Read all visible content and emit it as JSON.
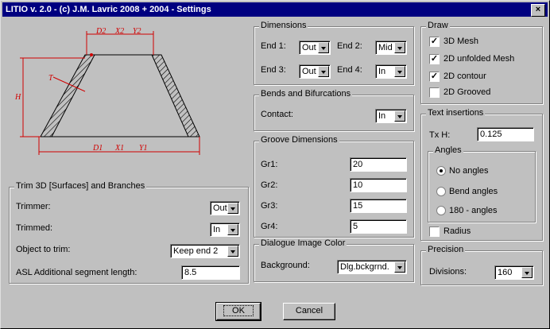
{
  "window": {
    "title": "LITIO v. 2.0 - (c) J.M. Lavric 2008 + 2004 - Settings",
    "close": "×"
  },
  "diagram": {
    "labels": {
      "d2": "D2",
      "x2": "X2",
      "y2": "Y2",
      "d1": "D1",
      "x1": "X1",
      "y1": "Y1",
      "h": "H",
      "t": "T"
    }
  },
  "dimensions": {
    "title": "Dimensions",
    "end1": {
      "label": "End 1:",
      "value": "Out"
    },
    "end2": {
      "label": "End 2:",
      "value": "Mid"
    },
    "end3": {
      "label": "End 3:",
      "value": "Out"
    },
    "end4": {
      "label": "End 4:",
      "value": "In"
    }
  },
  "bends": {
    "title": "Bends and Bifurcations",
    "contact_label": "Contact:",
    "contact_value": "In"
  },
  "groove": {
    "title": "Groove Dimensions",
    "rows": [
      {
        "label": "Gr1:",
        "value": "20"
      },
      {
        "label": "Gr2:",
        "value": "10"
      },
      {
        "label": "Gr3:",
        "value": "15"
      },
      {
        "label": "Gr4:",
        "value": "5"
      }
    ]
  },
  "dialogue_color": {
    "title": "Dialogue Image Color",
    "background_label": "Background:",
    "background_value": "Dlg.bckgrnd."
  },
  "trim": {
    "title": "Trim 3D [Surfaces] and Branches",
    "trimmer_label": "Trimmer:",
    "trimmer_value": "Out",
    "trimmed_label": "Trimmed:",
    "trimmed_value": "In",
    "object_label": "Object to trim:",
    "object_value": "Keep end 2",
    "asl_label": "ASL Additional segment length:",
    "asl_value": "8.5"
  },
  "draw": {
    "title": "Draw",
    "items": [
      {
        "label": "3D Mesh",
        "checked": true,
        "mark": "✓"
      },
      {
        "label": "2D unfolded Mesh",
        "checked": true,
        "mark": "✓"
      },
      {
        "label": "2D contour",
        "checked": true,
        "mark": "✓"
      },
      {
        "label": "2D Grooved",
        "checked": false,
        "mark": ""
      }
    ]
  },
  "text_insertions": {
    "title": "Text insertions",
    "txh_label": "Tx H:",
    "txh_value": "0.125",
    "angles_title": "Angles",
    "angles": [
      {
        "label": "No angles",
        "selected": true
      },
      {
        "label": "Bend angles",
        "selected": false
      },
      {
        "label": "180 - angles",
        "selected": false
      }
    ],
    "radius_label": "Radius",
    "radius_checked": false
  },
  "precision": {
    "title": "Precision",
    "divisions_label": "Divisions:",
    "divisions_value": "160"
  },
  "buttons": {
    "ok": "OK",
    "cancel": "Cancel"
  }
}
